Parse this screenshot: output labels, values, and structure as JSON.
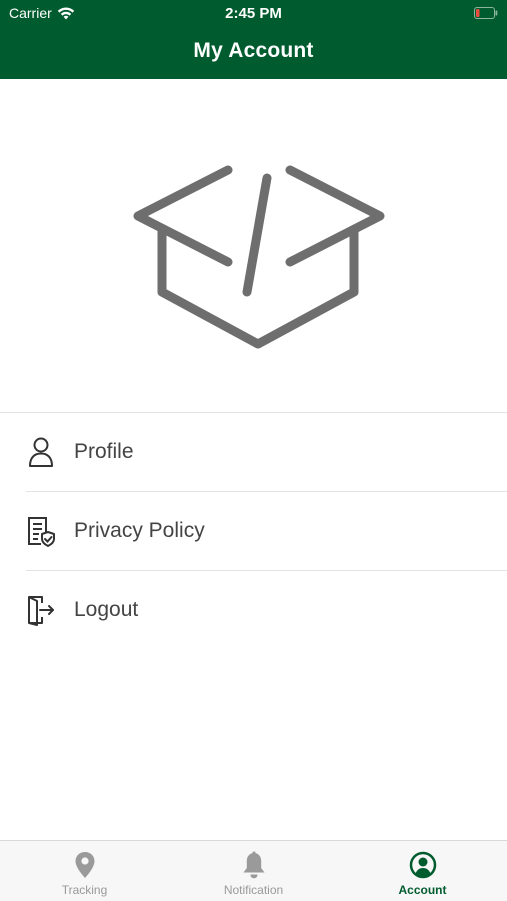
{
  "status_bar": {
    "carrier": "Carrier",
    "time": "2:45 PM"
  },
  "header": {
    "title": "My Account"
  },
  "menu": {
    "items": [
      {
        "label": "Profile",
        "icon": "user-icon"
      },
      {
        "label": "Privacy Policy",
        "icon": "privacy-document-icon"
      },
      {
        "label": "Logout",
        "icon": "logout-icon"
      }
    ]
  },
  "tabbar": {
    "tabs": [
      {
        "label": "Tracking",
        "icon": "location-pin-icon",
        "active": false
      },
      {
        "label": "Notification",
        "icon": "bell-icon",
        "active": false
      },
      {
        "label": "Account",
        "icon": "account-circle-icon",
        "active": true
      }
    ]
  },
  "colors": {
    "brand": "#005c2e",
    "logo_gray": "#6e6e6e",
    "menu_text": "#444444",
    "tab_inactive": "#999999",
    "battery_low": "#e74c3c"
  }
}
